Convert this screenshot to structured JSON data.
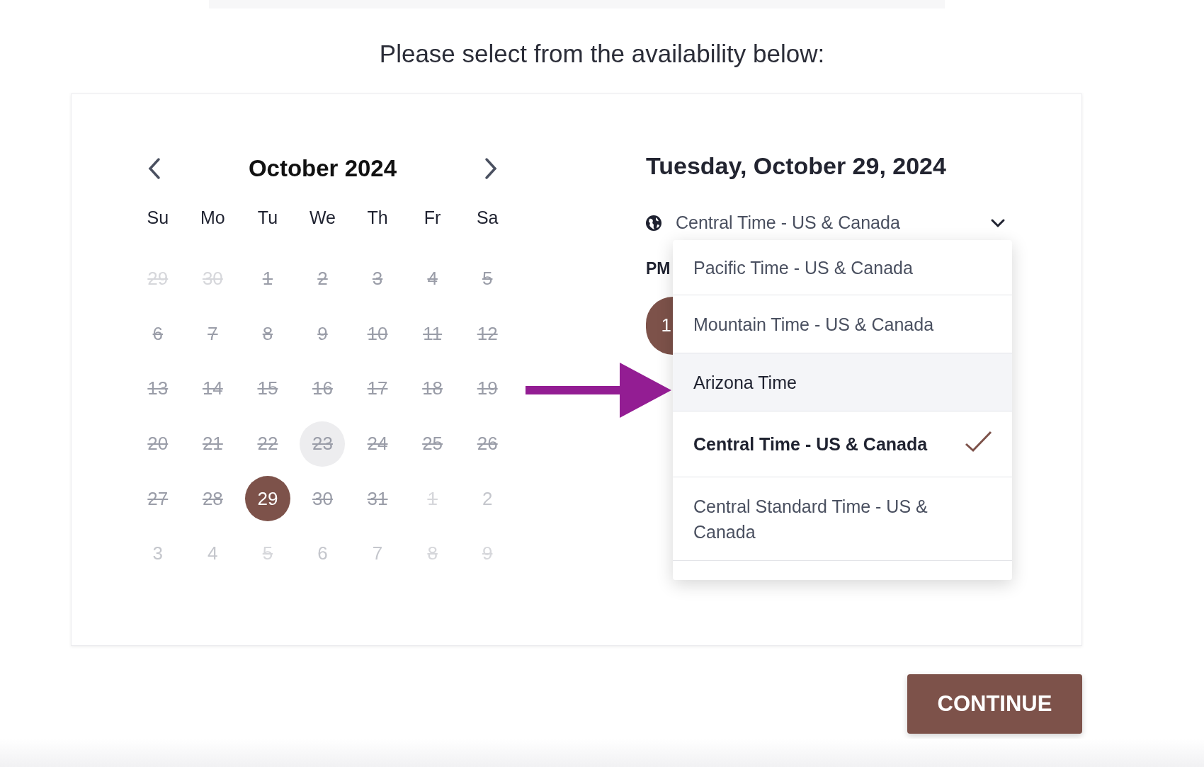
{
  "heading": "Please select from the availability below:",
  "calendar": {
    "month": "October 2024",
    "weekdays": [
      "Su",
      "Mo",
      "Tu",
      "We",
      "Th",
      "Fr",
      "Sa"
    ],
    "days": [
      {
        "label": "29",
        "outside": true,
        "struck": true,
        "selected": false,
        "hovered": false
      },
      {
        "label": "30",
        "outside": true,
        "struck": true,
        "selected": false,
        "hovered": false
      },
      {
        "label": "1",
        "outside": false,
        "struck": true,
        "selected": false,
        "hovered": false
      },
      {
        "label": "2",
        "outside": false,
        "struck": true,
        "selected": false,
        "hovered": false
      },
      {
        "label": "3",
        "outside": false,
        "struck": true,
        "selected": false,
        "hovered": false
      },
      {
        "label": "4",
        "outside": false,
        "struck": true,
        "selected": false,
        "hovered": false
      },
      {
        "label": "5",
        "outside": false,
        "struck": true,
        "selected": false,
        "hovered": false
      },
      {
        "label": "6",
        "outside": false,
        "struck": true,
        "selected": false,
        "hovered": false
      },
      {
        "label": "7",
        "outside": false,
        "struck": true,
        "selected": false,
        "hovered": false
      },
      {
        "label": "8",
        "outside": false,
        "struck": true,
        "selected": false,
        "hovered": false
      },
      {
        "label": "9",
        "outside": false,
        "struck": true,
        "selected": false,
        "hovered": false
      },
      {
        "label": "10",
        "outside": false,
        "struck": true,
        "selected": false,
        "hovered": false
      },
      {
        "label": "11",
        "outside": false,
        "struck": true,
        "selected": false,
        "hovered": false
      },
      {
        "label": "12",
        "outside": false,
        "struck": true,
        "selected": false,
        "hovered": false
      },
      {
        "label": "13",
        "outside": false,
        "struck": true,
        "selected": false,
        "hovered": false
      },
      {
        "label": "14",
        "outside": false,
        "struck": true,
        "selected": false,
        "hovered": false
      },
      {
        "label": "15",
        "outside": false,
        "struck": true,
        "selected": false,
        "hovered": false
      },
      {
        "label": "16",
        "outside": false,
        "struck": true,
        "selected": false,
        "hovered": false
      },
      {
        "label": "17",
        "outside": false,
        "struck": true,
        "selected": false,
        "hovered": false
      },
      {
        "label": "18",
        "outside": false,
        "struck": true,
        "selected": false,
        "hovered": false
      },
      {
        "label": "19",
        "outside": false,
        "struck": true,
        "selected": false,
        "hovered": false
      },
      {
        "label": "20",
        "outside": false,
        "struck": true,
        "selected": false,
        "hovered": false
      },
      {
        "label": "21",
        "outside": false,
        "struck": true,
        "selected": false,
        "hovered": false
      },
      {
        "label": "22",
        "outside": false,
        "struck": true,
        "selected": false,
        "hovered": false
      },
      {
        "label": "23",
        "outside": false,
        "struck": true,
        "selected": false,
        "hovered": true
      },
      {
        "label": "24",
        "outside": false,
        "struck": true,
        "selected": false,
        "hovered": false
      },
      {
        "label": "25",
        "outside": false,
        "struck": true,
        "selected": false,
        "hovered": false
      },
      {
        "label": "26",
        "outside": false,
        "struck": true,
        "selected": false,
        "hovered": false
      },
      {
        "label": "27",
        "outside": false,
        "struck": true,
        "selected": false,
        "hovered": false
      },
      {
        "label": "28",
        "outside": false,
        "struck": true,
        "selected": false,
        "hovered": false
      },
      {
        "label": "29",
        "outside": false,
        "struck": false,
        "selected": true,
        "hovered": false
      },
      {
        "label": "30",
        "outside": false,
        "struck": true,
        "selected": false,
        "hovered": false
      },
      {
        "label": "31",
        "outside": false,
        "struck": true,
        "selected": false,
        "hovered": false
      },
      {
        "label": "1",
        "outside": true,
        "struck": true,
        "selected": false,
        "hovered": false
      },
      {
        "label": "2",
        "outside": true,
        "struck": false,
        "selected": false,
        "hovered": false
      },
      {
        "label": "3",
        "outside": true,
        "struck": false,
        "selected": false,
        "hovered": false
      },
      {
        "label": "4",
        "outside": true,
        "struck": false,
        "selected": false,
        "hovered": false
      },
      {
        "label": "5",
        "outside": true,
        "struck": true,
        "selected": false,
        "hovered": false
      },
      {
        "label": "6",
        "outside": true,
        "struck": false,
        "selected": false,
        "hovered": false
      },
      {
        "label": "7",
        "outside": true,
        "struck": false,
        "selected": false,
        "hovered": false
      },
      {
        "label": "8",
        "outside": true,
        "struck": true,
        "selected": false,
        "hovered": false
      },
      {
        "label": "9",
        "outside": true,
        "struck": true,
        "selected": false,
        "hovered": false
      }
    ]
  },
  "schedule": {
    "date": "Tuesday, October 29, 2024",
    "timezone": "Central Time - US & Canada",
    "period": "PM",
    "time_slots": [
      {
        "label": "1"
      }
    ]
  },
  "timezone_menu": {
    "options": [
      {
        "label": "Pacific Time - US & Canada",
        "selected": false,
        "hovered": false
      },
      {
        "label": "Mountain Time - US & Canada",
        "selected": false,
        "hovered": false
      },
      {
        "label": "Arizona Time",
        "selected": false,
        "hovered": true
      },
      {
        "label": "Central Time - US & Canada",
        "selected": true,
        "hovered": false
      },
      {
        "label": "Central Standard Time - US & Canada",
        "selected": false,
        "hovered": false
      }
    ]
  },
  "button": "CONTINUE"
}
